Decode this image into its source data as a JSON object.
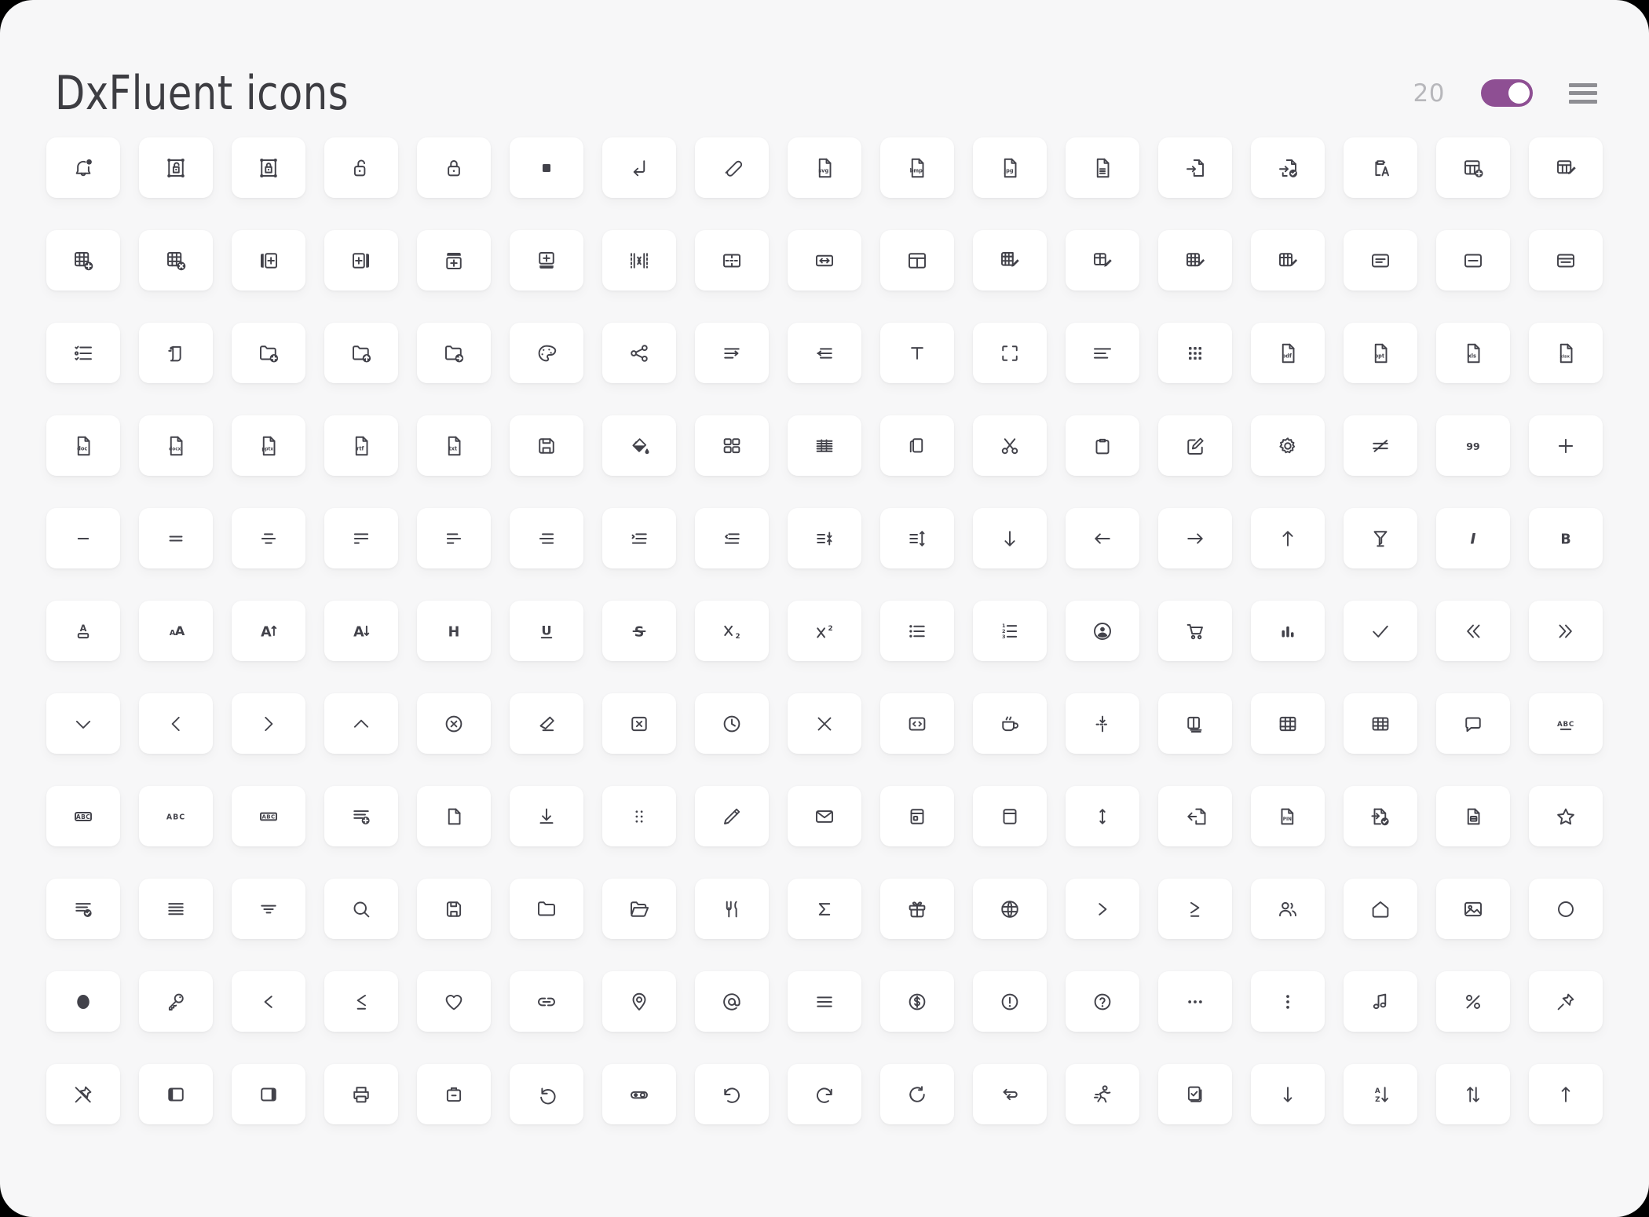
{
  "header": {
    "title": "DxFluent icons",
    "count": "20",
    "toggle_state": "on",
    "toggle_color": "#8e4f93",
    "menu_icon": "hamburger-menu-icon"
  },
  "theme": {
    "page_background": "#f7f7f8",
    "tile_background": "#ffffff",
    "icon_stroke": "#42424a",
    "count_color": "#b7b7bb",
    "title_color": "#3d3d42",
    "accent": "#8e4f93"
  },
  "grid": {
    "columns": 17,
    "rows": 11,
    "total_icons": 187,
    "icons": [
      "alert-bell-icon",
      "lock-open-frame-icon",
      "lock-closed-frame-icon",
      "unlock-icon",
      "lock-icon",
      "stop-square-icon",
      "arrow-enter-icon",
      "attach-paperclip-icon",
      "file-svg-icon",
      "file-bmp-icon",
      "file-jpg-icon",
      "file-document-icon",
      "file-import-icon",
      "file-import-check-icon",
      "clipboard-text-icon",
      "table-add-icon",
      "table-edit-icon",
      "table-insert-add-icon",
      "table-delete-icon",
      "insert-column-right-icon",
      "insert-column-left-icon",
      "insert-row-below-icon",
      "insert-row-above-icon",
      "merge-cells-icon",
      "split-cells-icon",
      "autofit-width-icon",
      "table-header-icon",
      "table-grid-edit-icon",
      "cell-edit-icon",
      "table-row-edit-icon",
      "table-column-edit-icon",
      "card-view-icon",
      "list-view-icon",
      "panel-view-icon",
      "checklist-icon",
      "layers-copy-icon",
      "folder-add-icon",
      "folder-upload-icon",
      "folder-move-icon",
      "palette-icon",
      "share-nodes-icon",
      "indent-arrow-right-icon",
      "outdent-arrow-left-icon",
      "text-tool-icon",
      "crop-frame-icon",
      "align-text-icon",
      "keypad-grid-icon",
      "file-pdf-icon",
      "file-ppt-icon",
      "file-xls-icon",
      "file-xlsx-icon",
      "file-doc-icon",
      "file-docx-icon",
      "file-pptx-icon",
      "file-rtf-icon",
      "file-txt-icon",
      "save-floppy-icon",
      "fill-color-icon",
      "dashboard-tiles-icon",
      "table-rows-dense-icon",
      "copy-icon",
      "cut-scissors-icon",
      "paste-icon",
      "compose-edit-icon",
      "settings-gear-icon",
      "strikethrough-line-icon",
      "quote-marks-icon",
      "plus-icon",
      "minus-dash-icon",
      "align-justify-two-icon",
      "align-center-icon",
      "align-left-icon",
      "align-left-short-icon",
      "align-right-icon",
      "indent-increase-icon",
      "indent-decrease-icon",
      "line-spacing-decrease-icon",
      "line-spacing-increase-icon",
      "arrow-down-icon",
      "arrow-left-icon",
      "arrow-right-icon",
      "arrow-up-icon",
      "highlighter-icon",
      "italic-icon",
      "bold-icon",
      "font-color-icon",
      "font-size-icon",
      "font-increase-icon",
      "font-decrease-icon",
      "heading-icon",
      "underline-icon",
      "strikethrough-icon",
      "subscript-icon",
      "superscript-icon",
      "bullet-list-icon",
      "numbered-list-icon",
      "user-circle-icon",
      "shopping-cart-icon",
      "bar-chart-icon",
      "check-icon",
      "chevrons-left-icon",
      "chevrons-right-icon",
      "chevron-down-icon",
      "chevron-left-icon",
      "chevron-right-icon",
      "chevron-up-icon",
      "close-circle-icon",
      "eraser-icon",
      "close-square-icon",
      "clock-icon",
      "close-x-icon",
      "code-brackets-icon",
      "coffee-cup-icon",
      "collapse-vertical-icon",
      "columns-stack-icon",
      "table-borders-icon",
      "grid-table-icon",
      "comment-bubble-icon",
      "spellcheck-abc-icon",
      "text-box-abc-icon",
      "abc-letters-icon",
      "abc-outline-icon",
      "export-list-icon",
      "blank-page-icon",
      "download-icon",
      "drag-dots-icon",
      "pencil-edit-icon",
      "envelope-icon",
      "window-panel-icon",
      "card-blank-icon",
      "resize-vertical-icon",
      "file-export-icon",
      "file-pin-icon",
      "file-check-icon",
      "file-card-icon",
      "star-icon",
      "task-list-check-icon",
      "lines-stack-icon",
      "filter-lines-icon",
      "search-icon",
      "save-disk-icon",
      "folder-closed-icon",
      "folder-open-icon",
      "restaurant-icon",
      "sum-sigma-icon",
      "gift-icon",
      "globe-icon",
      "greater-than-icon",
      "greater-equal-icon",
      "group-users-icon",
      "home-icon",
      "image-icon",
      "circle-outline-icon",
      "circle-filled-icon",
      "key-icon",
      "less-than-icon",
      "less-equal-icon",
      "heart-icon",
      "link-icon",
      "location-pin-icon",
      "at-sign-icon",
      "menu-lines-icon",
      "dollar-circle-icon",
      "warning-circle-icon",
      "question-circle-icon",
      "more-horizontal-icon",
      "more-vertical-icon",
      "music-note-icon",
      "percent-icon",
      "pin-icon",
      "unpin-icon",
      "panel-left-icon",
      "panel-right-icon",
      "printer-icon",
      "briefcase-icon",
      "undo-rotate-icon",
      "toggle-switch-icon",
      "undo-arrow-icon",
      "redo-arrow-icon",
      "refresh-icon",
      "repeat-icon",
      "run-person-icon",
      "task-checkbox-icon",
      "sort-down-icon",
      "sort-alpha-down-icon",
      "sort-updown-icon",
      "sort-up-icon"
    ]
  }
}
